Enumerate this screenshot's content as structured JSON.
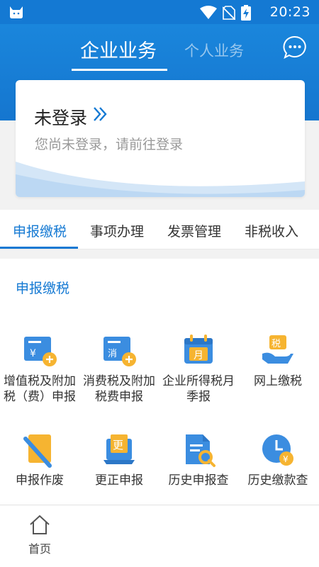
{
  "status_bar": {
    "time": "20:23",
    "icons": [
      "cat-app-icon",
      "wifi-icon",
      "no-sim-icon",
      "battery-charging-icon"
    ]
  },
  "header": {
    "tabs": [
      {
        "label": "企业业务",
        "active": true
      },
      {
        "label": "个人业务",
        "active": false
      }
    ],
    "icon": "chat-bubble-icon"
  },
  "login_card": {
    "title": "未登录",
    "subtitle": "您尚未登录，请前往登录"
  },
  "categories": [
    {
      "label": "申报缴税",
      "active": true
    },
    {
      "label": "事项办理",
      "active": false
    },
    {
      "label": "发票管理",
      "active": false
    },
    {
      "label": "非税收入",
      "active": false
    }
  ],
  "section": {
    "title": "申报缴税",
    "items": [
      {
        "label": "增值税及附加税（费）申报",
        "icon": "vat-invoice-icon"
      },
      {
        "label": "消费税及附加税费申报",
        "icon": "consumption-tax-icon"
      },
      {
        "label": "企业所得税月季报",
        "icon": "calendar-month-icon"
      },
      {
        "label": "网上缴税",
        "icon": "online-pay-tax-icon"
      },
      {
        "label": "申报作废",
        "icon": "void-declaration-icon"
      },
      {
        "label": "更正申报",
        "icon": "correct-declaration-icon"
      },
      {
        "label": "历史申报查",
        "icon": "history-declaration-search-icon"
      },
      {
        "label": "历史缴款查",
        "icon": "history-payment-clock-icon"
      }
    ],
    "icon_glyphs": {
      "vat": "¥",
      "consumption": "消",
      "month": "月",
      "tax": "税",
      "correct": "更",
      "payment": "¥"
    }
  },
  "bottom_nav": {
    "items": [
      {
        "label": "首页",
        "icon": "home-icon"
      }
    ]
  },
  "colors": {
    "primary": "#1479d3",
    "accent_orange": "#f6b431",
    "icon_blue": "#3b8de0"
  }
}
